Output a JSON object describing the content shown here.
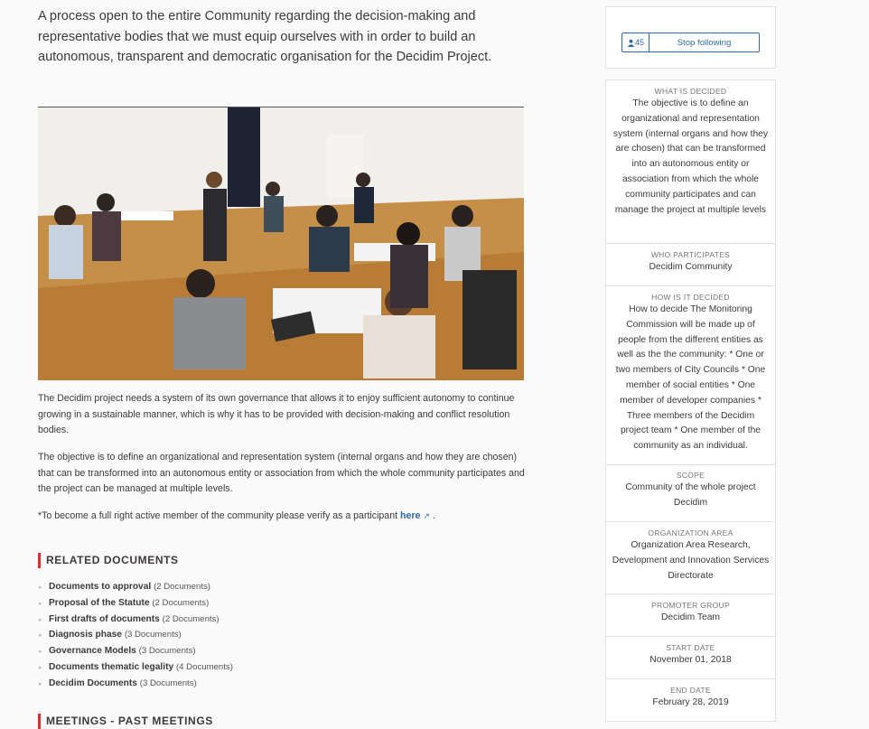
{
  "intro": "A process open to the entire Community regarding the decision-making and representative bodies that we must equip ourselves with in order to build an autonomous, transparent and democratic organisation for the Decidim Project.",
  "paragraphs": [
    "The Decidim project needs a system of its own governance that allows it to enjoy sufficient autonomy to continue growing in a sustainable manner, which is why it has to be provided with decision-making and conflict resolution bodies.",
    "The objective is to define an organizational and representation system (internal organs and how they are chosen) that can be transformed into an autonomous entity or association from which the whole community participates and the project can be managed at multiple levels."
  ],
  "verify": {
    "prefix": "*To become a full right active member of the community please verify as a participant ",
    "link": "here",
    "suffix": " ."
  },
  "related_documents": {
    "title": "RELATED DOCUMENTS",
    "items": [
      {
        "name": "Documents to approval",
        "count": "(2 Documents)"
      },
      {
        "name": "Proposal of the Statute",
        "count": "(2 Documents)"
      },
      {
        "name": "First drafts of documents",
        "count": "(2 Documents)"
      },
      {
        "name": "Diagnosis phase",
        "count": "(3 Documents)"
      },
      {
        "name": "Governance Models",
        "count": "(3 Documents)"
      },
      {
        "name": "Documents thematic legality",
        "count": "(4 Documents)"
      },
      {
        "name": "Decidim Documents",
        "count": "(3 Documents)"
      }
    ]
  },
  "next_section_title": "MEETINGS - PAST MEETINGS",
  "follow": {
    "count": "45",
    "label": "Stop following"
  },
  "metadata": [
    {
      "label": "WHAT IS DECIDED",
      "value": "The objective is to define an organizational and representation system (internal organs and how they are chosen) that can be transformed into an autonomous entity or association from which the whole community participates and can manage the project at multiple levels"
    },
    {
      "label": "WHO PARTICIPATES",
      "value": "Decidim Community"
    },
    {
      "label": "HOW IS IT DECIDED",
      "value": "How to decide The Monitoring Commission will be made up of people from the different entities as well as the the community: * One or two members of City Councils * One member of social entities * One member of developer companies * Three members of the Decidim project team * One member of the community as an individual."
    },
    {
      "label": "SCOPE",
      "value": "Community of the whole project Decidim"
    },
    {
      "label": "ORGANIZATION AREA",
      "value": "Organization Area Research, Development and Innovation Services Directorate"
    },
    {
      "label": "PROMOTER GROUP",
      "value": "Decidim Team"
    },
    {
      "label": "START DATE",
      "value": "November 01, 2018"
    },
    {
      "label": "END DATE",
      "value": "February 28, 2019"
    }
  ],
  "icons": {
    "follow": "users-icon",
    "external": "external-link-icon",
    "photo": "workshop-photo"
  }
}
